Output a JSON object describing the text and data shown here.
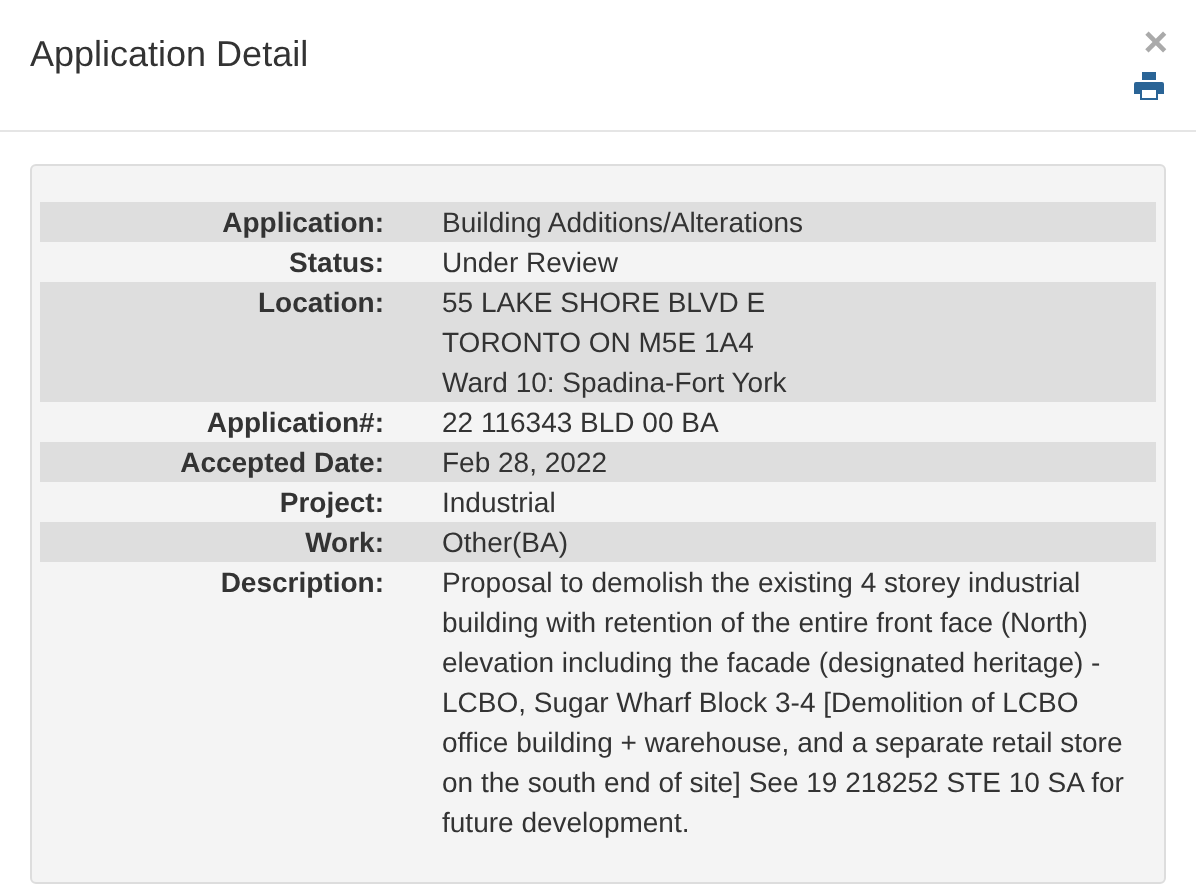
{
  "window": {
    "title": "Application Detail",
    "close": "×"
  },
  "details": [
    {
      "label": "Application:",
      "lines": [
        "Building Additions/Alterations"
      ]
    },
    {
      "label": "Status:",
      "lines": [
        "Under Review"
      ]
    },
    {
      "label": "Location:",
      "lines": [
        "55 LAKE SHORE BLVD E",
        "TORONTO ON M5E 1A4",
        "Ward 10: Spadina-Fort York"
      ]
    },
    {
      "label": "Application#:",
      "lines": [
        "22 116343 BLD 00 BA"
      ]
    },
    {
      "label": "Accepted Date:",
      "lines": [
        "Feb 28, 2022"
      ]
    },
    {
      "label": "Project:",
      "lines": [
        "Industrial"
      ]
    },
    {
      "label": "Work:",
      "lines": [
        "Other(BA)"
      ]
    },
    {
      "label": "Description:",
      "lines": [
        "Proposal to demolish the existing 4 storey industrial building with retention of the entire front face (North) elevation including the facade (designated heritage) - LCBO, Sugar Wharf Block 3-4 [Demolition of LCBO office building + warehouse, and a separate retail store on the south end of site] See 19 218252 STE 10 SA for future development."
      ]
    }
  ]
}
